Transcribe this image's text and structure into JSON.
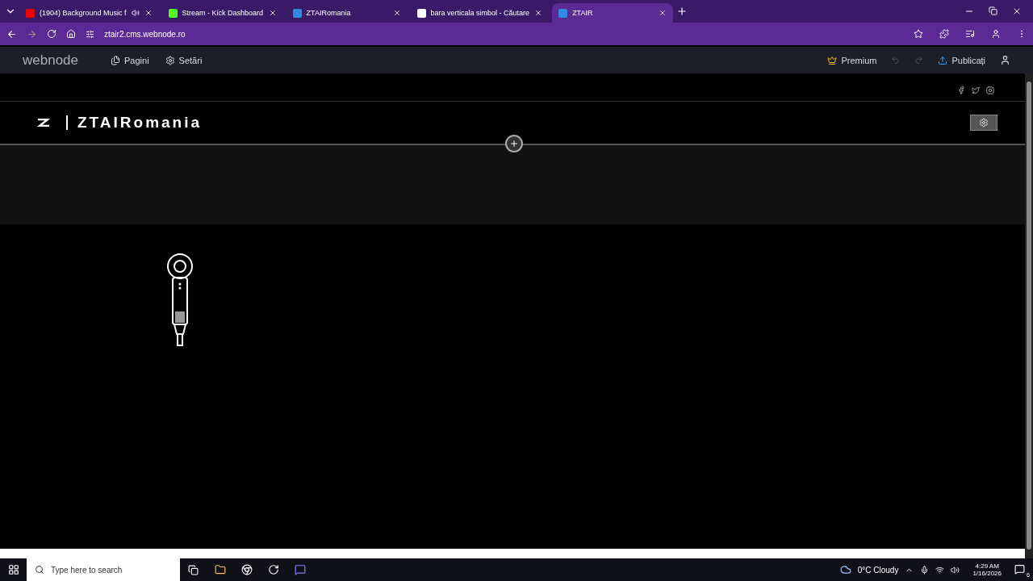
{
  "browser": {
    "tabs": [
      {
        "title": "(1904) Background Music f",
        "selected": false,
        "kind": "video"
      },
      {
        "title": "Stream - Kick Dashboard",
        "selected": false,
        "kind": "kick"
      },
      {
        "title": "ZTAIRomania",
        "selected": false,
        "kind": "webnode"
      },
      {
        "title": "bara verticala simbol - Căutare",
        "selected": false,
        "kind": "google"
      },
      {
        "title": "ZTAIR",
        "selected": true,
        "kind": "webnode"
      }
    ],
    "address": "ztair2.cms.webnode.ro"
  },
  "editor_toolbar": {
    "logo": "webnode",
    "nav": [
      "Pagini",
      "Setări"
    ],
    "premium": "Premium",
    "publish": "Publicați"
  },
  "site": {
    "brand": "ZTAIRomania"
  },
  "taskbar": {
    "search_placeholder": "Type here to search",
    "weather": "0°C Cloudy",
    "time": "4:29 AM",
    "date": "1/16/2026",
    "notifications": "6"
  }
}
